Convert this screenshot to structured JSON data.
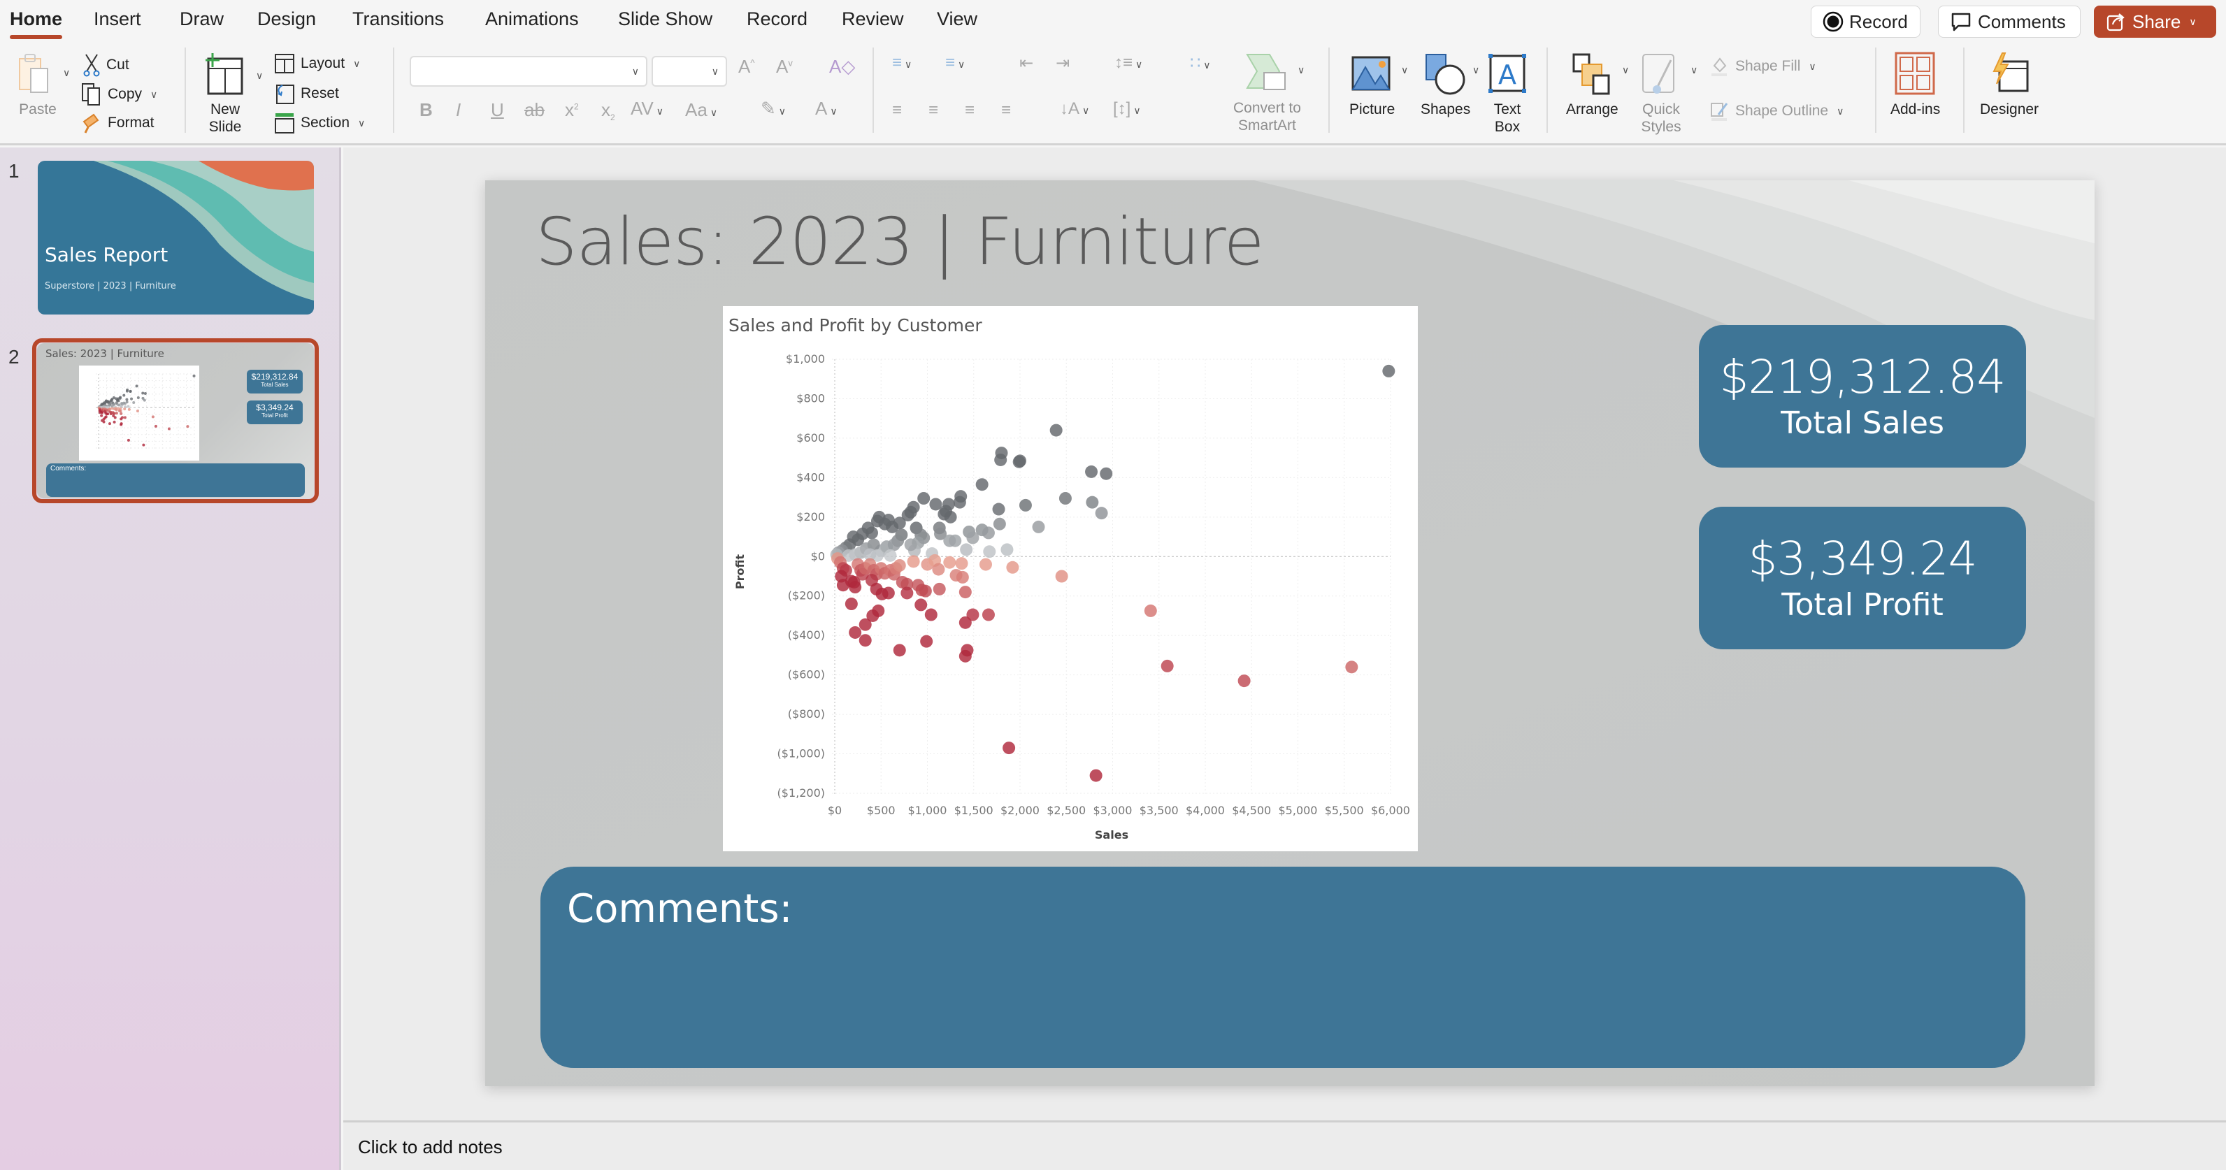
{
  "tabs": [
    "Home",
    "Insert",
    "Draw",
    "Design",
    "Transitions",
    "Animations",
    "Slide Show",
    "Record",
    "Review",
    "View"
  ],
  "active_tab": "Home",
  "top_buttons": {
    "record": "Record",
    "comments": "Comments",
    "share": "Share"
  },
  "ribbon": {
    "paste": "Paste",
    "cut": "Cut",
    "copy": "Copy",
    "format": "Format",
    "new_slide": [
      "New",
      "Slide"
    ],
    "layout": "Layout",
    "reset": "Reset",
    "section": "Section",
    "font_name": "",
    "font_size": "",
    "convert_smartart": [
      "Convert to",
      "SmartArt"
    ],
    "picture": "Picture",
    "shapes": "Shapes",
    "text_box": [
      "Text",
      "Box"
    ],
    "arrange": "Arrange",
    "quick_styles": [
      "Quick",
      "Styles"
    ],
    "shape_fill": "Shape Fill",
    "shape_outline": "Shape Outline",
    "add_ins": "Add-ins",
    "designer": "Designer"
  },
  "thumbnails": [
    {
      "number": "1",
      "title": "Sales Report",
      "subtitle": "Superstore | 2023 | Furniture"
    },
    {
      "number": "2",
      "title": "Sales: 2023 | Furniture",
      "kpi1_value": "$219,312.84",
      "kpi1_label": "Total Sales",
      "kpi2_value": "$3,349.24",
      "kpi2_label": "Total Profit",
      "comments": "Comments:"
    }
  ],
  "slide": {
    "title": "Sales: 2023 | Furniture",
    "kpis": [
      {
        "value": "$219,312.84",
        "label": "Total Sales"
      },
      {
        "value": "$3,349.24",
        "label": "Total Profit"
      }
    ],
    "comments_label": "Comments:"
  },
  "notes_placeholder": "Click to add notes",
  "colors": {
    "accent": "#b7472a",
    "slide_box": "#3e7596",
    "slide_bg": "#c5c7c6",
    "title_text": "#5a5a5a"
  },
  "chart_data": {
    "type": "scatter",
    "title": "Sales and Profit by Customer",
    "xlabel": "Sales",
    "ylabel": "Profit",
    "xlim": [
      0,
      6000
    ],
    "ylim": [
      -1200,
      1000
    ],
    "x_ticks": [
      "$0",
      "$500",
      "$1,000",
      "$1,500",
      "$2,000",
      "$2,500",
      "$3,000",
      "$3,500",
      "$4,000",
      "$4,500",
      "$5,000",
      "$5,500",
      "$6,000"
    ],
    "y_ticks": [
      "$1,000",
      "$800",
      "$600",
      "$400",
      "$200",
      "$0",
      "($200)",
      "($400)",
      "($600)",
      "($800)",
      "($1,000)",
      "($1,200)"
    ],
    "grid": true,
    "color_encoding": "profit (diverging red to grey)",
    "points": [
      [
        5980,
        940
      ],
      [
        2390,
        640
      ],
      [
        1800,
        525
      ],
      [
        1790,
        490
      ],
      [
        2000,
        485
      ],
      [
        1990,
        480
      ],
      [
        2770,
        430
      ],
      [
        2930,
        420
      ],
      [
        1590,
        365
      ],
      [
        960,
        295
      ],
      [
        1360,
        305
      ],
      [
        1350,
        275
      ],
      [
        1090,
        265
      ],
      [
        1230,
        265
      ],
      [
        2060,
        260
      ],
      [
        2490,
        295
      ],
      [
        2780,
        275
      ],
      [
        2880,
        220
      ],
      [
        1770,
        240
      ],
      [
        1780,
        165
      ],
      [
        2200,
        150
      ],
      [
        1130,
        145
      ],
      [
        1140,
        115
      ],
      [
        1450,
        125
      ],
      [
        1590,
        135
      ],
      [
        1660,
        120
      ],
      [
        1490,
        95
      ],
      [
        1240,
        80
      ],
      [
        1300,
        80
      ],
      [
        1420,
        35
      ],
      [
        1670,
        25
      ],
      [
        1860,
        35
      ],
      [
        850,
        250
      ],
      [
        790,
        210
      ],
      [
        820,
        225
      ],
      [
        1200,
        230
      ],
      [
        1180,
        215
      ],
      [
        1250,
        200
      ],
      [
        700,
        170
      ],
      [
        480,
        200
      ],
      [
        460,
        180
      ],
      [
        540,
        165
      ],
      [
        580,
        185
      ],
      [
        620,
        150
      ],
      [
        400,
        120
      ],
      [
        360,
        145
      ],
      [
        300,
        115
      ],
      [
        200,
        100
      ],
      [
        250,
        85
      ],
      [
        160,
        60
      ],
      [
        120,
        45
      ],
      [
        80,
        30
      ],
      [
        40,
        20
      ],
      [
        20,
        10
      ],
      [
        880,
        145
      ],
      [
        930,
        110
      ],
      [
        960,
        95
      ],
      [
        900,
        70
      ],
      [
        860,
        30
      ],
      [
        1050,
        15
      ],
      [
        820,
        60
      ],
      [
        720,
        110
      ],
      [
        680,
        80
      ],
      [
        640,
        60
      ],
      [
        560,
        50
      ],
      [
        500,
        30
      ],
      [
        420,
        60
      ],
      [
        340,
        40
      ],
      [
        280,
        20
      ],
      [
        220,
        10
      ],
      [
        600,
        5
      ],
      [
        460,
        5
      ],
      [
        380,
        10
      ],
      [
        150,
        5
      ],
      [
        30,
        -10
      ],
      [
        60,
        -30
      ],
      [
        90,
        -60
      ],
      [
        120,
        -70
      ],
      [
        70,
        -100
      ],
      [
        90,
        -145
      ],
      [
        180,
        -125
      ],
      [
        210,
        -130
      ],
      [
        220,
        -155
      ],
      [
        180,
        -240
      ],
      [
        220,
        -385
      ],
      [
        330,
        -345
      ],
      [
        330,
        -425
      ],
      [
        410,
        -300
      ],
      [
        470,
        -275
      ],
      [
        700,
        -475
      ],
      [
        990,
        -430
      ],
      [
        1410,
        -505
      ],
      [
        1430,
        -475
      ],
      [
        250,
        -40
      ],
      [
        280,
        -70
      ],
      [
        300,
        -90
      ],
      [
        330,
        -60
      ],
      [
        380,
        -40
      ],
      [
        420,
        -70
      ],
      [
        450,
        -90
      ],
      [
        500,
        -60
      ],
      [
        540,
        -85
      ],
      [
        600,
        -70
      ],
      [
        640,
        -90
      ],
      [
        660,
        -60
      ],
      [
        700,
        -45
      ],
      [
        730,
        -130
      ],
      [
        780,
        -140
      ],
      [
        400,
        -120
      ],
      [
        450,
        -165
      ],
      [
        510,
        -190
      ],
      [
        580,
        -185
      ],
      [
        780,
        -185
      ],
      [
        900,
        -145
      ],
      [
        940,
        -170
      ],
      [
        980,
        -175
      ],
      [
        1130,
        -165
      ],
      [
        1410,
        -180
      ],
      [
        930,
        -245
      ],
      [
        1040,
        -295
      ],
      [
        1410,
        -335
      ],
      [
        1490,
        -295
      ],
      [
        1660,
        -295
      ],
      [
        850,
        -25
      ],
      [
        1000,
        -40
      ],
      [
        1080,
        -20
      ],
      [
        1120,
        -65
      ],
      [
        1240,
        -30
      ],
      [
        1370,
        -35
      ],
      [
        1310,
        -95
      ],
      [
        1380,
        -105
      ],
      [
        1630,
        -40
      ],
      [
        1920,
        -55
      ],
      [
        2450,
        -100
      ],
      [
        3410,
        -275
      ],
      [
        3590,
        -555
      ],
      [
        4420,
        -630
      ],
      [
        5580,
        -560
      ],
      [
        1880,
        -970
      ],
      [
        2820,
        -1110
      ]
    ]
  }
}
